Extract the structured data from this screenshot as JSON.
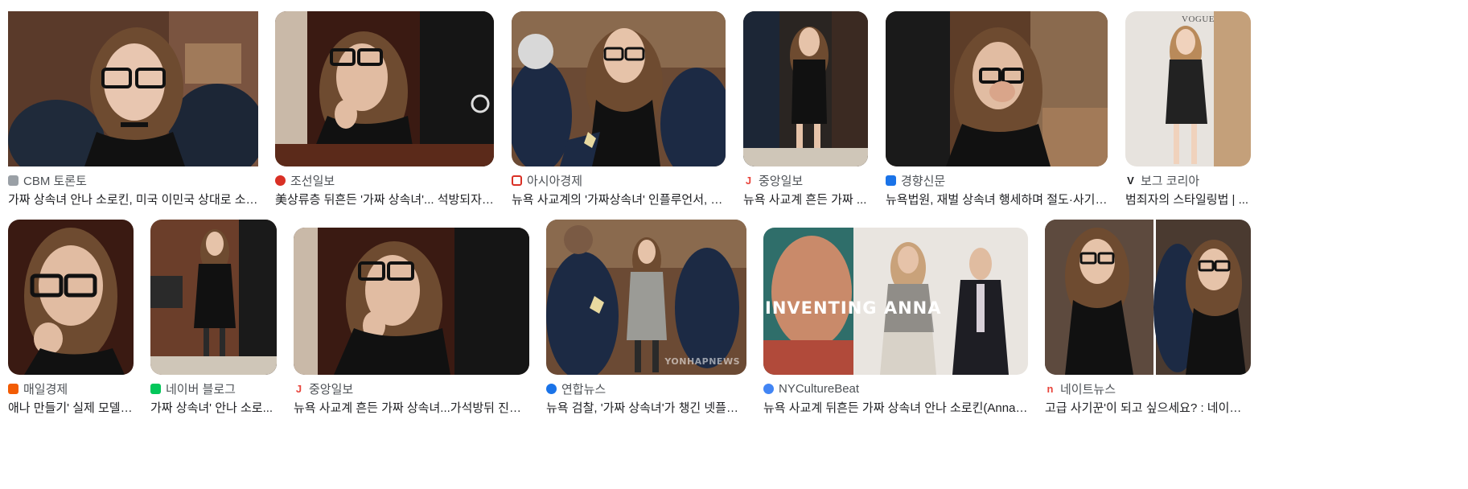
{
  "results_row1": [
    {
      "source": "CBM 토론토",
      "caption": "가짜 상속녀 안나 소로킨, 미국 이민국 상대로 소송 ...",
      "icon": "cbm-favicon-icon",
      "color": "#9aa0a6"
    },
    {
      "source": "조선일보",
      "caption": "美상류층 뒤흔든 '가짜 상속녀'... 석방되자 '...",
      "icon": "chosun-favicon-icon",
      "color": "#d93025"
    },
    {
      "source": "아시아경제",
      "caption": "뉴욕 사교계의 '가짜상속녀' 인플루언서, 징...",
      "icon": "asiae-favicon-icon",
      "color": "#d93025"
    },
    {
      "source": "중앙일보",
      "caption": "뉴욕 사교계 흔든 가짜 ...",
      "icon": "joongang-favicon-icon",
      "color": "#e8453c"
    },
    {
      "source": "경향신문",
      "caption": "뉴욕법원, 재벌 상속녀 행세하며 절도·사기행...",
      "icon": "khan-favicon-icon",
      "color": "#1a73e8"
    },
    {
      "source": "보그 코리아",
      "caption": "범죄자의 스타일링법 | ...",
      "icon": "vogue-favicon-icon",
      "color": "#202124"
    }
  ],
  "results_row2": [
    {
      "source": "매일경제",
      "caption": "애나 만들기' 실제 모델 ...",
      "icon": "mk-favicon-icon",
      "color": "#f25c05"
    },
    {
      "source": "네이버 블로그",
      "caption": "가짜 상속녀' 안나 소로...",
      "icon": "naver-blog-favicon-icon",
      "color": "#03c75a"
    },
    {
      "source": "중앙일보",
      "caption": "뉴욕 사교계 흔든 가짜 상속녀...가석방뒤 진짜 ...",
      "icon": "joongang-favicon-icon",
      "color": "#e8453c"
    },
    {
      "source": "연합뉴스",
      "caption": "뉴욕 검찰, '가짜 상속녀'가 챙긴 넷플릭...",
      "icon": "yonhap-favicon-icon",
      "color": "#1a73e8"
    },
    {
      "source": "NYCultureBeat",
      "caption": "뉴욕 사교계 뒤흔든 가짜 상속녀 안나 소로킨(Anna So...",
      "icon": "nyculturebeat-favicon-icon",
      "color": "#4285f4"
    },
    {
      "source": "네이트뉴스",
      "caption": "고급 사기꾼'이 되고 싶으세요? : 네이트 ...",
      "icon": "nate-favicon-icon",
      "color": "#e8453c"
    }
  ],
  "watermark": "YONHAPNEWS",
  "vogue_mark": "VOGUE",
  "poster_title": "INVENTING ANNA"
}
